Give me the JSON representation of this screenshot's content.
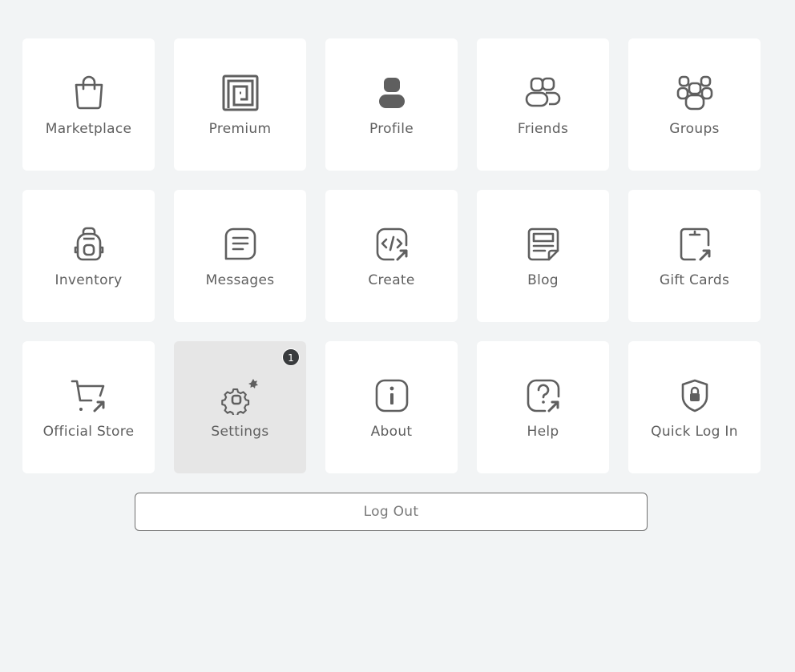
{
  "colors": {
    "background": "#f2f4f5",
    "tile": "#ffffff",
    "tile_active": "#e6e6e6",
    "icon": "#5f5f5f",
    "label": "#5f5f5f",
    "badge": "#393b3d"
  },
  "tiles": [
    {
      "label": "Marketplace",
      "icon": "shopping-bag-icon"
    },
    {
      "label": "Premium",
      "icon": "premium-icon"
    },
    {
      "label": "Profile",
      "icon": "person-icon"
    },
    {
      "label": "Friends",
      "icon": "friends-icon"
    },
    {
      "label": "Groups",
      "icon": "groups-icon"
    },
    {
      "label": "Inventory",
      "icon": "backpack-icon"
    },
    {
      "label": "Messages",
      "icon": "message-icon"
    },
    {
      "label": "Create",
      "icon": "code-external-icon"
    },
    {
      "label": "Blog",
      "icon": "blog-icon"
    },
    {
      "label": "Gift Cards",
      "icon": "gift-card-icon"
    },
    {
      "label": "Official Store",
      "icon": "cart-external-icon"
    },
    {
      "label": "Settings",
      "icon": "gear-icon",
      "badge": "1",
      "active": true
    },
    {
      "label": "About",
      "icon": "info-icon"
    },
    {
      "label": "Help",
      "icon": "help-external-icon"
    },
    {
      "label": "Quick Log In",
      "icon": "shield-lock-icon"
    }
  ],
  "logout": {
    "label": "Log Out"
  }
}
